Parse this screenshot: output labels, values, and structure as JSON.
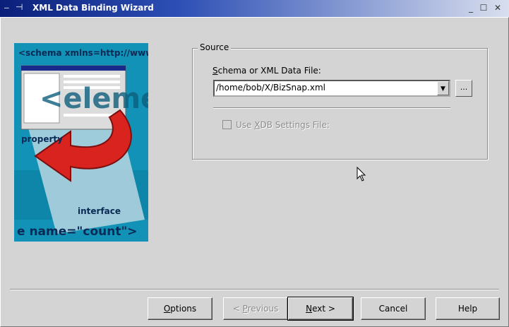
{
  "window": {
    "title": "XML Data Binding Wizard"
  },
  "source": {
    "legend": "Source",
    "schema_label": "Schema or XML Data File:",
    "schema_value": "/home/bob/X/BizSnap.xml",
    "browse_label": "...",
    "xdb_label": "Use XDB Settings File:",
    "xdb_checked": false
  },
  "artwork": {
    "lines": [
      "<schema xmlns=http://www",
      "<eleme",
      "property",
      "interface",
      "e name=\"count\">"
    ]
  },
  "buttons": {
    "options": "Options",
    "previous": "< Previous",
    "next": "Next >",
    "cancel": "Cancel",
    "help": "Help"
  },
  "colors": {
    "title_start": "#0a1f7a",
    "artwork_bg": "#1192b6",
    "dialog_bg": "#d4d4d4"
  }
}
